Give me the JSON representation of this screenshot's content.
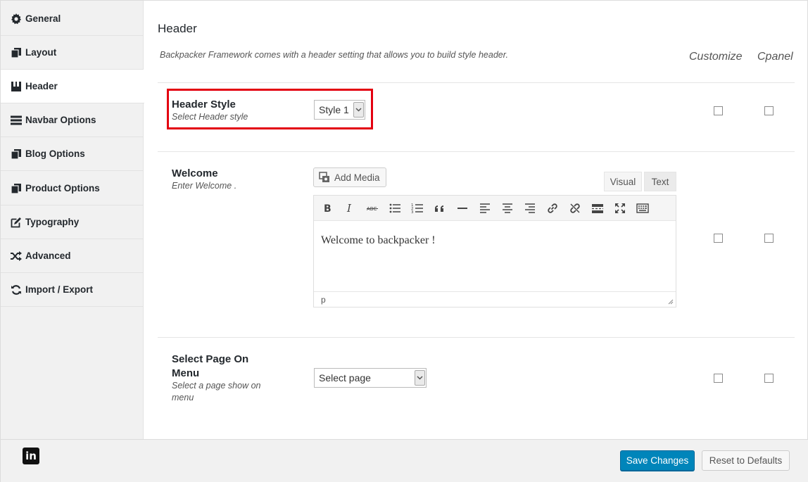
{
  "sidebar": {
    "items": [
      {
        "label": "General",
        "icon": "gear-icon"
      },
      {
        "label": "Layout",
        "icon": "copy-icon"
      },
      {
        "label": "Header",
        "icon": "header-icon"
      },
      {
        "label": "Navbar Options",
        "icon": "menu-icon"
      },
      {
        "label": "Blog Options",
        "icon": "copy-icon"
      },
      {
        "label": "Product Options",
        "icon": "copy-icon"
      },
      {
        "label": "Typography",
        "icon": "edit-icon"
      },
      {
        "label": "Advanced",
        "icon": "shuffle-icon"
      },
      {
        "label": "Import / Export",
        "icon": "refresh-icon"
      }
    ],
    "active": "Header"
  },
  "main": {
    "title": "Header",
    "description": "Backpacker Framework comes with a header setting that allows you to build style header.",
    "columns": {
      "customize": "Customize",
      "cpanel": "Cpanel"
    },
    "options": {
      "header_style": {
        "title": "Header Style",
        "subtitle": "Select Header style",
        "value": "Style 1"
      },
      "welcome": {
        "title": "Welcome",
        "subtitle": "Enter Welcome .",
        "add_media": "Add Media",
        "tab_visual": "Visual",
        "tab_text": "Text",
        "content": "Welcome to backpacker !",
        "status_path": "p"
      },
      "select_page": {
        "title": "Select Page On Menu",
        "subtitle": "Select a page show on menu",
        "value": "Select page"
      }
    }
  },
  "footer": {
    "save_label": "Save Changes",
    "reset_label": "Reset to Defaults",
    "social_icon": "linkedin-icon",
    "social_glyph": "in"
  },
  "colors": {
    "primary": "#0085ba",
    "highlight": "#e30010",
    "sidebar_bg": "#f1f1f1"
  }
}
